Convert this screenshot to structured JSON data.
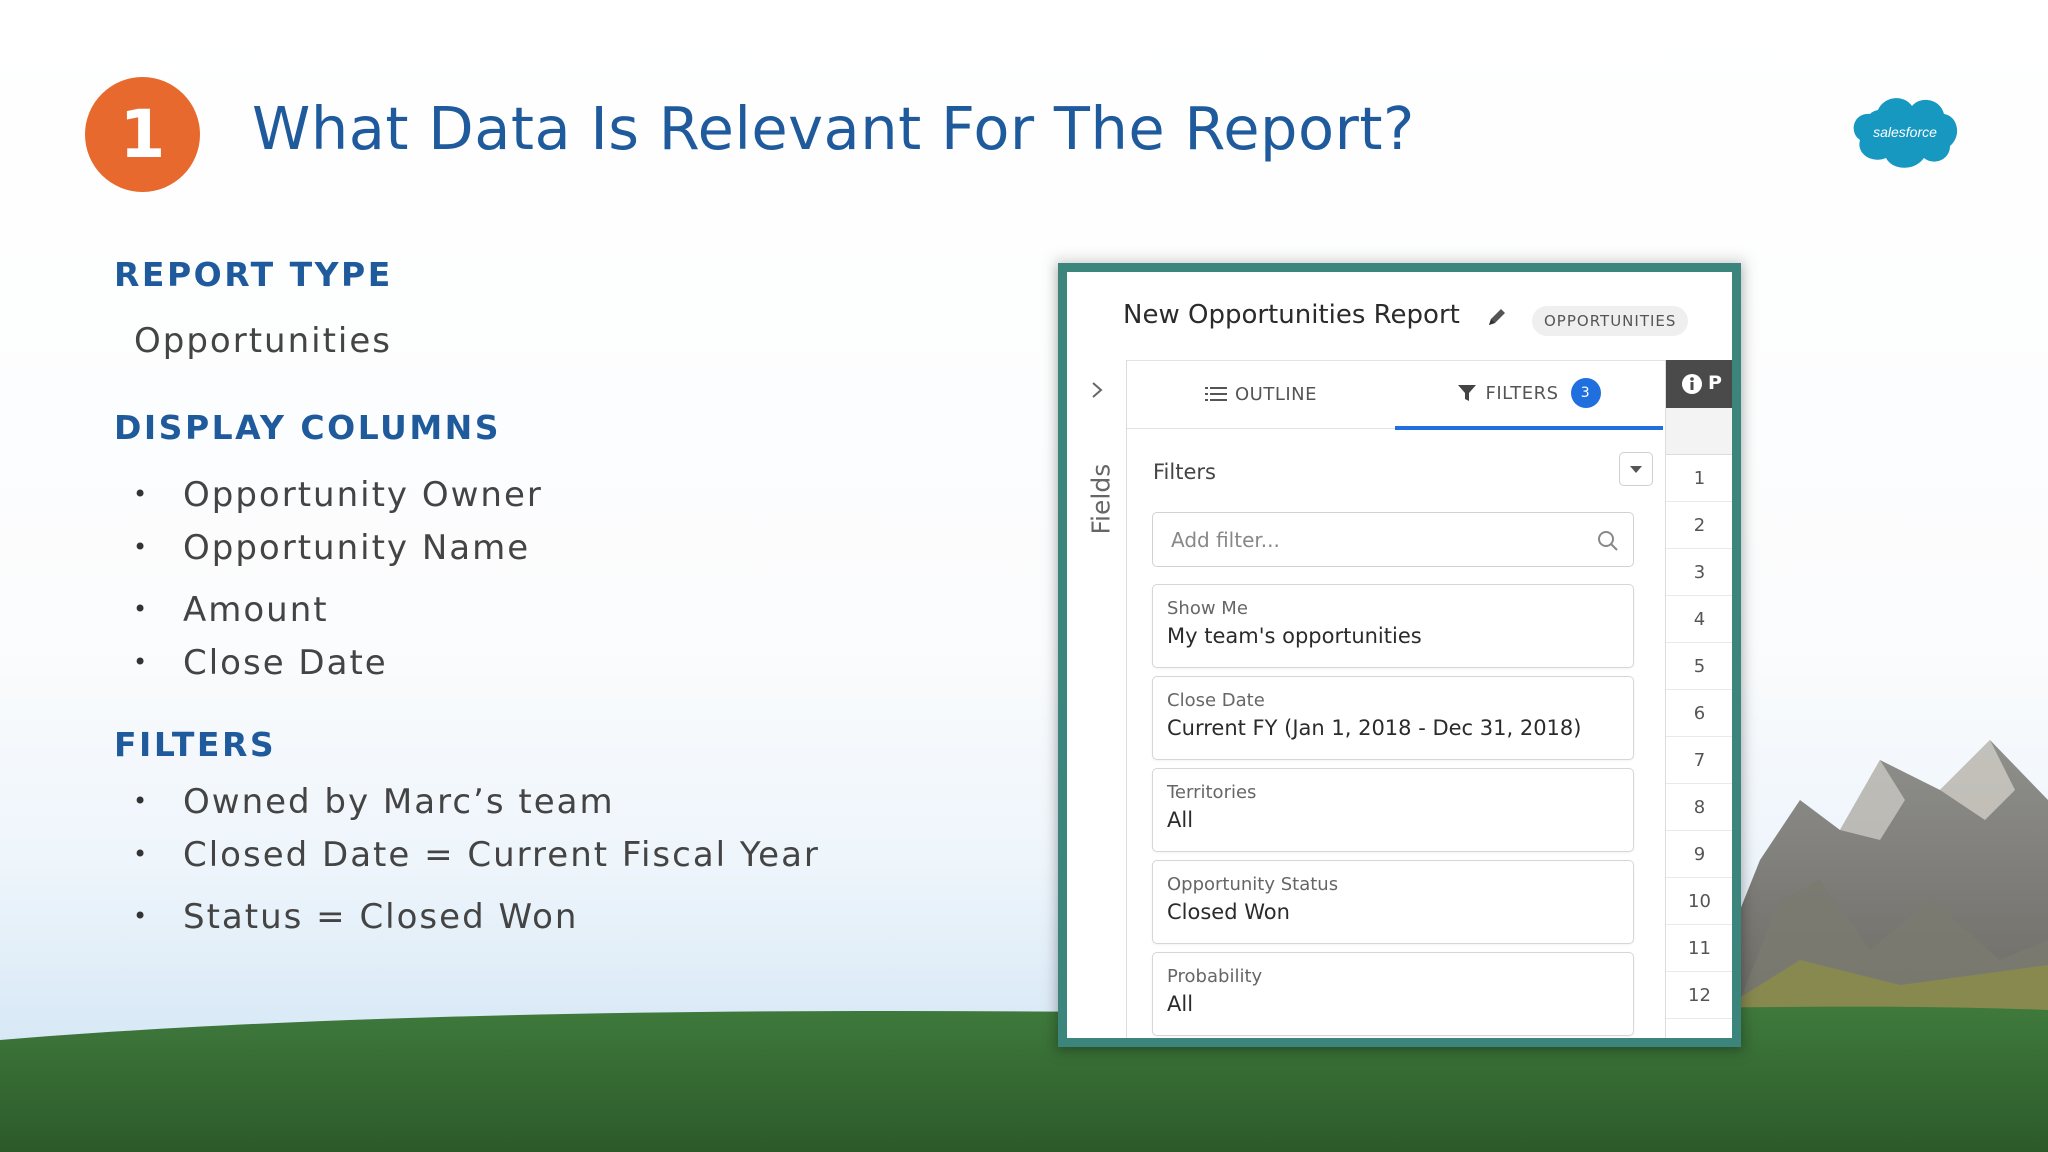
{
  "slide": {
    "step_number": "1",
    "title": "What Data Is Relevant For The Report?",
    "logo_text": "salesforce",
    "colors": {
      "accent_orange": "#e8692d",
      "title_blue": "#1f5b9c",
      "panel_teal": "#3c857c",
      "filter_blue": "#1f6fdf"
    }
  },
  "report_type": {
    "heading": "REPORT TYPE",
    "value": "Opportunities"
  },
  "display_columns": {
    "heading": "DISPLAY COLUMNS",
    "items": [
      "Opportunity Owner",
      "Opportunity Name",
      "Amount",
      "Close Date"
    ]
  },
  "filters_section": {
    "heading": "FILTERS",
    "items": [
      "Owned by Marc’s team",
      "Closed Date = Current Fiscal Year",
      "Status = Closed Won"
    ]
  },
  "bullet_glyph": "•",
  "report_panel": {
    "title": "New Opportunities Report",
    "type_badge": "OPPORTUNITIES",
    "fields_label": "Fields",
    "tabs": {
      "outline": "OUTLINE",
      "filters": "FILTERS",
      "filter_count": "3"
    },
    "filters_label": "Filters",
    "add_filter_placeholder": "Add filter...",
    "filter_cards": [
      {
        "label": "Show Me",
        "value": "My team's opportunities"
      },
      {
        "label": "Close Date",
        "value": "Current FY (Jan 1, 2018 - Dec 31, 2018)"
      },
      {
        "label": "Territories",
        "value": "All"
      },
      {
        "label": "Opportunity Status",
        "value": "Closed Won"
      },
      {
        "label": "Probability",
        "value": "All"
      }
    ],
    "grid_header": "P",
    "row_numbers": [
      "1",
      "2",
      "3",
      "4",
      "5",
      "6",
      "7",
      "8",
      "9",
      "10",
      "11",
      "12"
    ],
    "icons": [
      "pencil-icon",
      "chevron-right-icon",
      "list-icon",
      "funnel-icon",
      "chevron-down-icon",
      "search-icon",
      "info-icon"
    ]
  }
}
